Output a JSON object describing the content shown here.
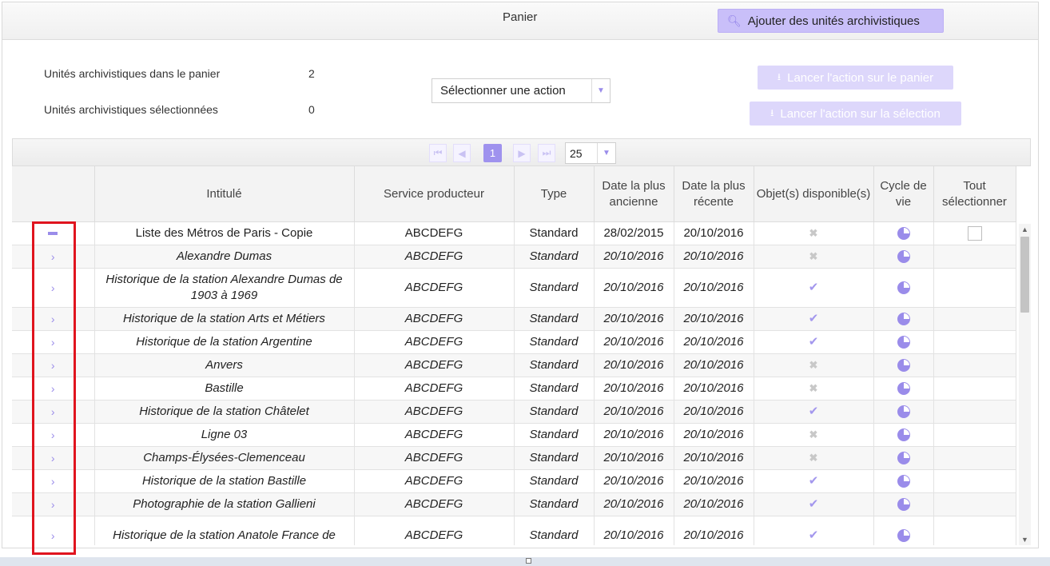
{
  "header": {
    "title": "Panier",
    "add_button_label": "Ajouter des unités archivistiques"
  },
  "summary": {
    "in_basket_label": "Unités archivistiques dans le panier",
    "in_basket_count": "2",
    "selected_label": "Unités archivistiques sélectionnées",
    "selected_count": "0"
  },
  "action_select": {
    "value": "Sélectionner une action"
  },
  "run_basket_label": "Lancer l'action sur le panier",
  "run_selection_label": "Lancer l'action sur la sélection",
  "pager": {
    "current_page": "1",
    "page_size": "25"
  },
  "columns": [
    "Intitulé",
    "Service producteur",
    "Type",
    "Date la plus ancienne",
    "Date la plus récente",
    "Objet(s) disponible(s)",
    "Cycle de vie",
    "Tout sélectionner"
  ],
  "rows": [
    {
      "expander": "minus",
      "title": "Liste des Métros de Paris - Copie",
      "producer": "ABCDEFG",
      "type": "Standard",
      "oldest": "28/02/2015",
      "newest": "20/10/2016",
      "available": false,
      "child": false,
      "checkbox": true
    },
    {
      "expander": "chevron",
      "title": "Alexandre Dumas",
      "producer": "ABCDEFG",
      "type": "Standard",
      "oldest": "20/10/2016",
      "newest": "20/10/2016",
      "available": false,
      "child": true
    },
    {
      "expander": "chevron",
      "title": "Historique de la station Alexandre Dumas de 1903 à 1969",
      "producer": "ABCDEFG",
      "type": "Standard",
      "oldest": "20/10/2016",
      "newest": "20/10/2016",
      "available": true,
      "child": true,
      "tall": true
    },
    {
      "expander": "chevron",
      "title": "Historique de la station Arts et Métiers",
      "producer": "ABCDEFG",
      "type": "Standard",
      "oldest": "20/10/2016",
      "newest": "20/10/2016",
      "available": true,
      "child": true
    },
    {
      "expander": "chevron",
      "title": "Historique de la station Argentine",
      "producer": "ABCDEFG",
      "type": "Standard",
      "oldest": "20/10/2016",
      "newest": "20/10/2016",
      "available": true,
      "child": true
    },
    {
      "expander": "chevron",
      "title": "Anvers",
      "producer": "ABCDEFG",
      "type": "Standard",
      "oldest": "20/10/2016",
      "newest": "20/10/2016",
      "available": false,
      "child": true
    },
    {
      "expander": "chevron",
      "title": "Bastille",
      "producer": "ABCDEFG",
      "type": "Standard",
      "oldest": "20/10/2016",
      "newest": "20/10/2016",
      "available": false,
      "child": true
    },
    {
      "expander": "chevron",
      "title": "Historique de la station Châtelet",
      "producer": "ABCDEFG",
      "type": "Standard",
      "oldest": "20/10/2016",
      "newest": "20/10/2016",
      "available": true,
      "child": true
    },
    {
      "expander": "chevron",
      "title": "Ligne 03",
      "producer": "ABCDEFG",
      "type": "Standard",
      "oldest": "20/10/2016",
      "newest": "20/10/2016",
      "available": false,
      "child": true
    },
    {
      "expander": "chevron",
      "title": "Champs-Élysées-Clemenceau",
      "producer": "ABCDEFG",
      "type": "Standard",
      "oldest": "20/10/2016",
      "newest": "20/10/2016",
      "available": false,
      "child": true
    },
    {
      "expander": "chevron",
      "title": "Historique de la station Bastille",
      "producer": "ABCDEFG",
      "type": "Standard",
      "oldest": "20/10/2016",
      "newest": "20/10/2016",
      "available": true,
      "child": true
    },
    {
      "expander": "chevron",
      "title": "Photographie de la station Gallieni",
      "producer": "ABCDEFG",
      "type": "Standard",
      "oldest": "20/10/2016",
      "newest": "20/10/2016",
      "available": true,
      "child": true
    },
    {
      "expander": "chevron",
      "title": "Historique de la station Anatole France de",
      "producer": "ABCDEFG",
      "type": "Standard",
      "oldest": "20/10/2016",
      "newest": "20/10/2016",
      "available": true,
      "child": true,
      "tall": true
    }
  ],
  "colors": {
    "accent": "#9a8cea",
    "accent_light": "#c9bff9",
    "highlight": "#e0141e"
  }
}
